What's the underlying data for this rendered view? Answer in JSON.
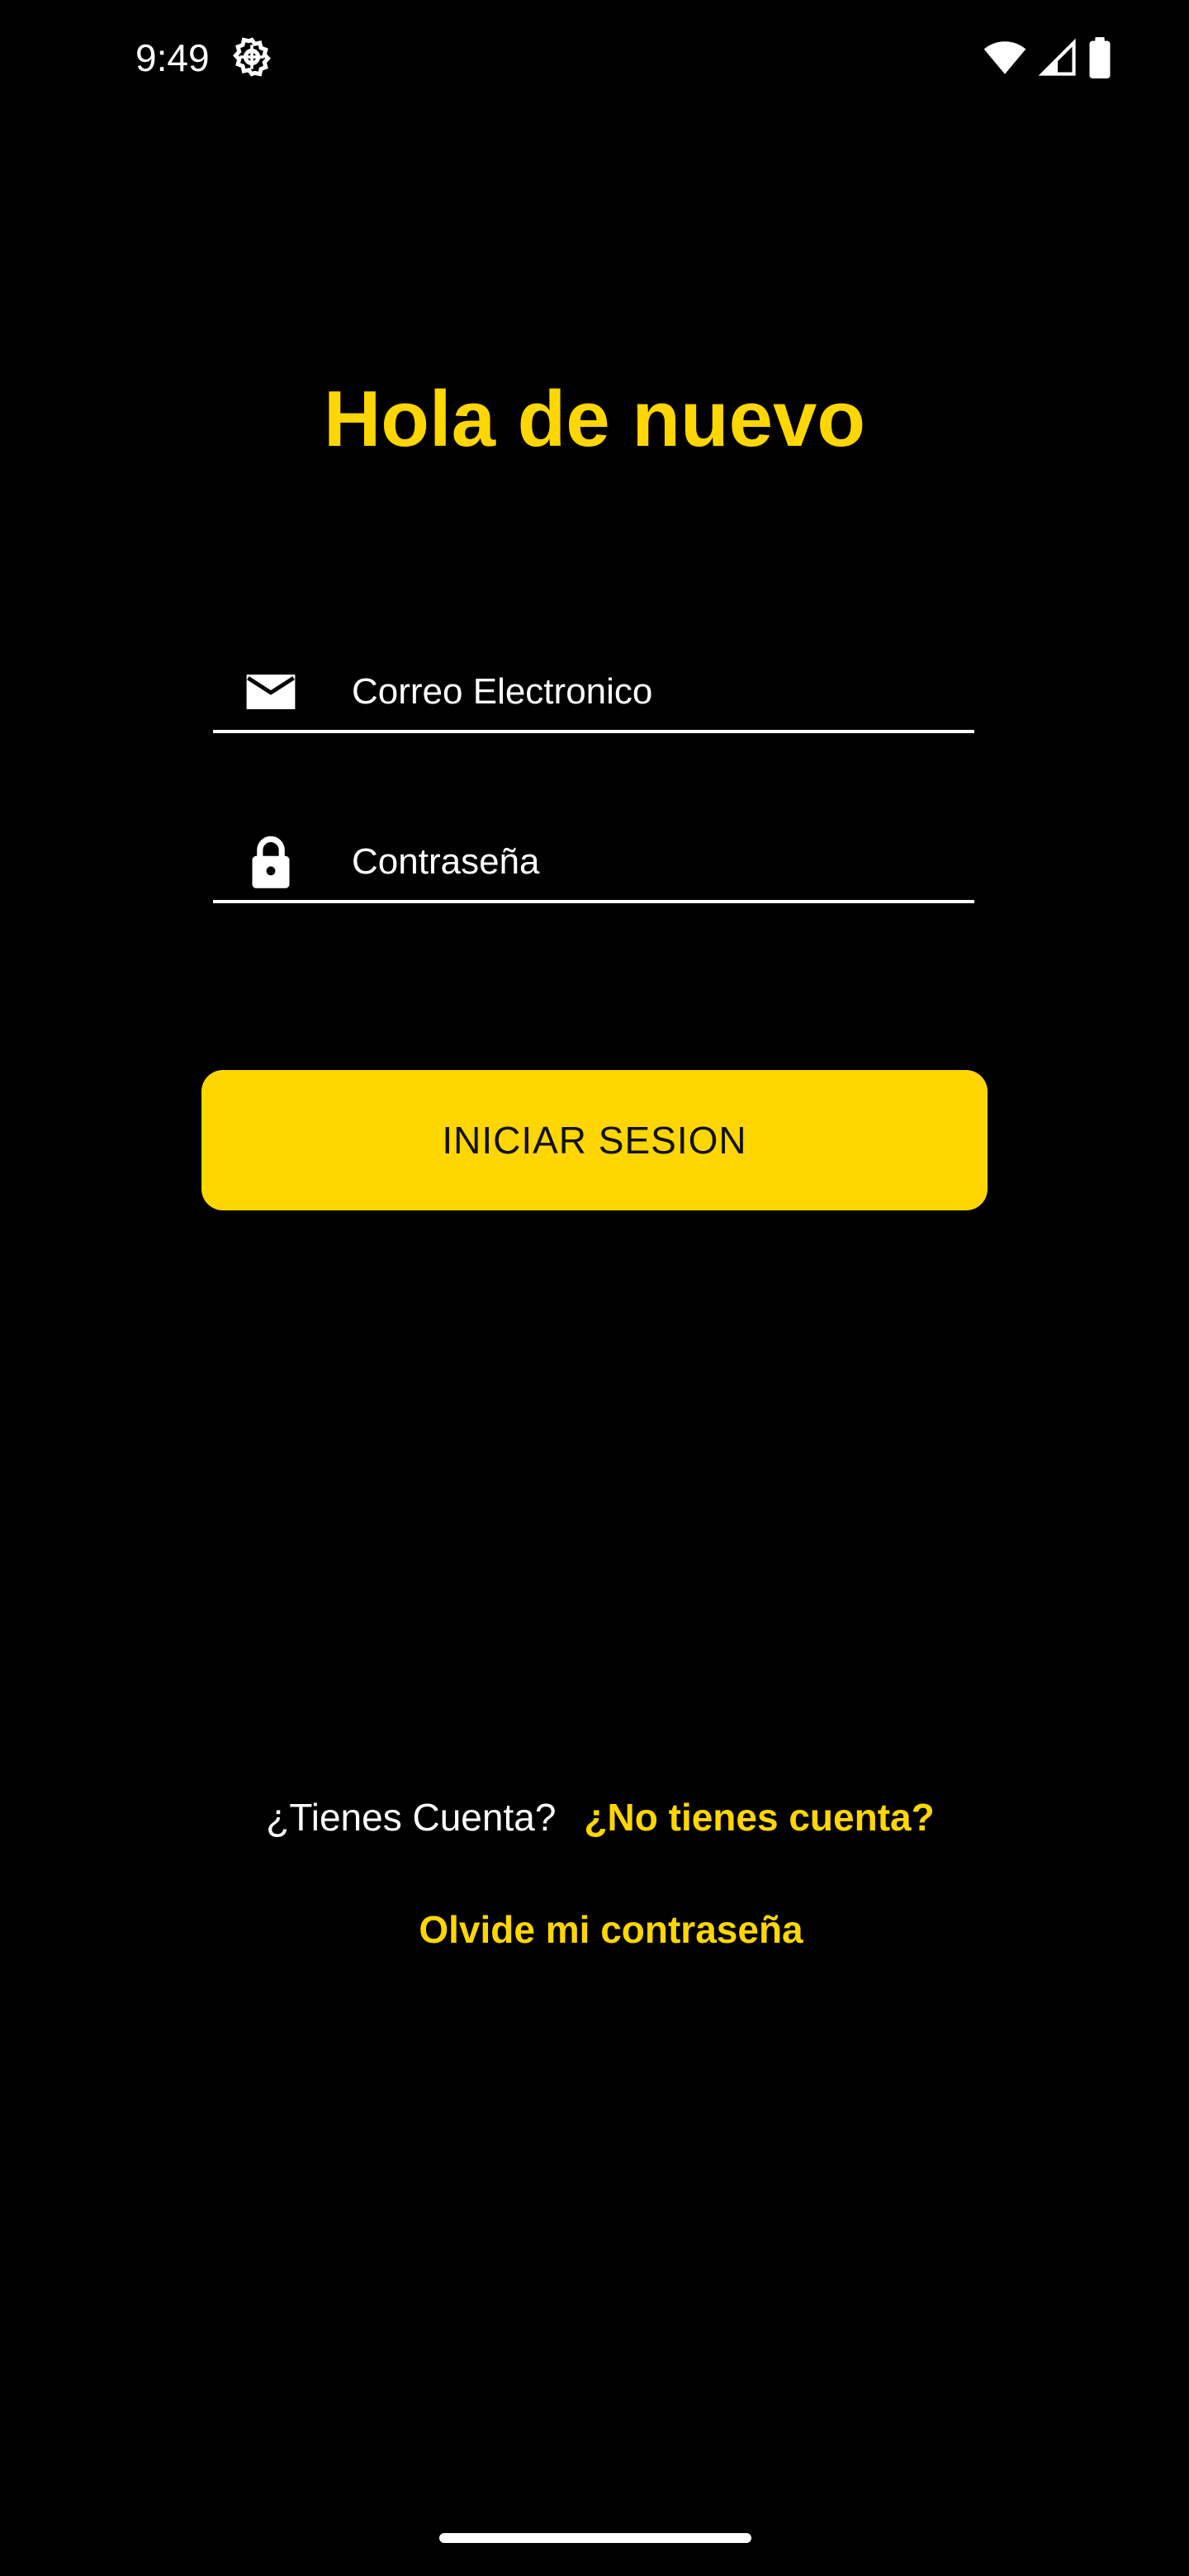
{
  "status_bar": {
    "time": "9:49",
    "icons": [
      "settings-gear-icon",
      "wifi-icon",
      "signal-icon",
      "battery-icon"
    ]
  },
  "login": {
    "title": "Hola de nuevo",
    "email": {
      "placeholder": "Correo Electronico",
      "value": "",
      "icon": "email-icon"
    },
    "password": {
      "placeholder": "Contraseña",
      "value": "",
      "icon": "lock-icon"
    },
    "submit_label": "INICIAR SESION"
  },
  "footer": {
    "account_question": "¿Tienes Cuenta?",
    "signup_link": "¿No tienes cuenta?",
    "forgot_password": "Olvide mi contraseña"
  },
  "colors": {
    "background": "#000000",
    "accent": "#FFD600",
    "text": "#FFFFFF",
    "button_text": "#111111"
  }
}
